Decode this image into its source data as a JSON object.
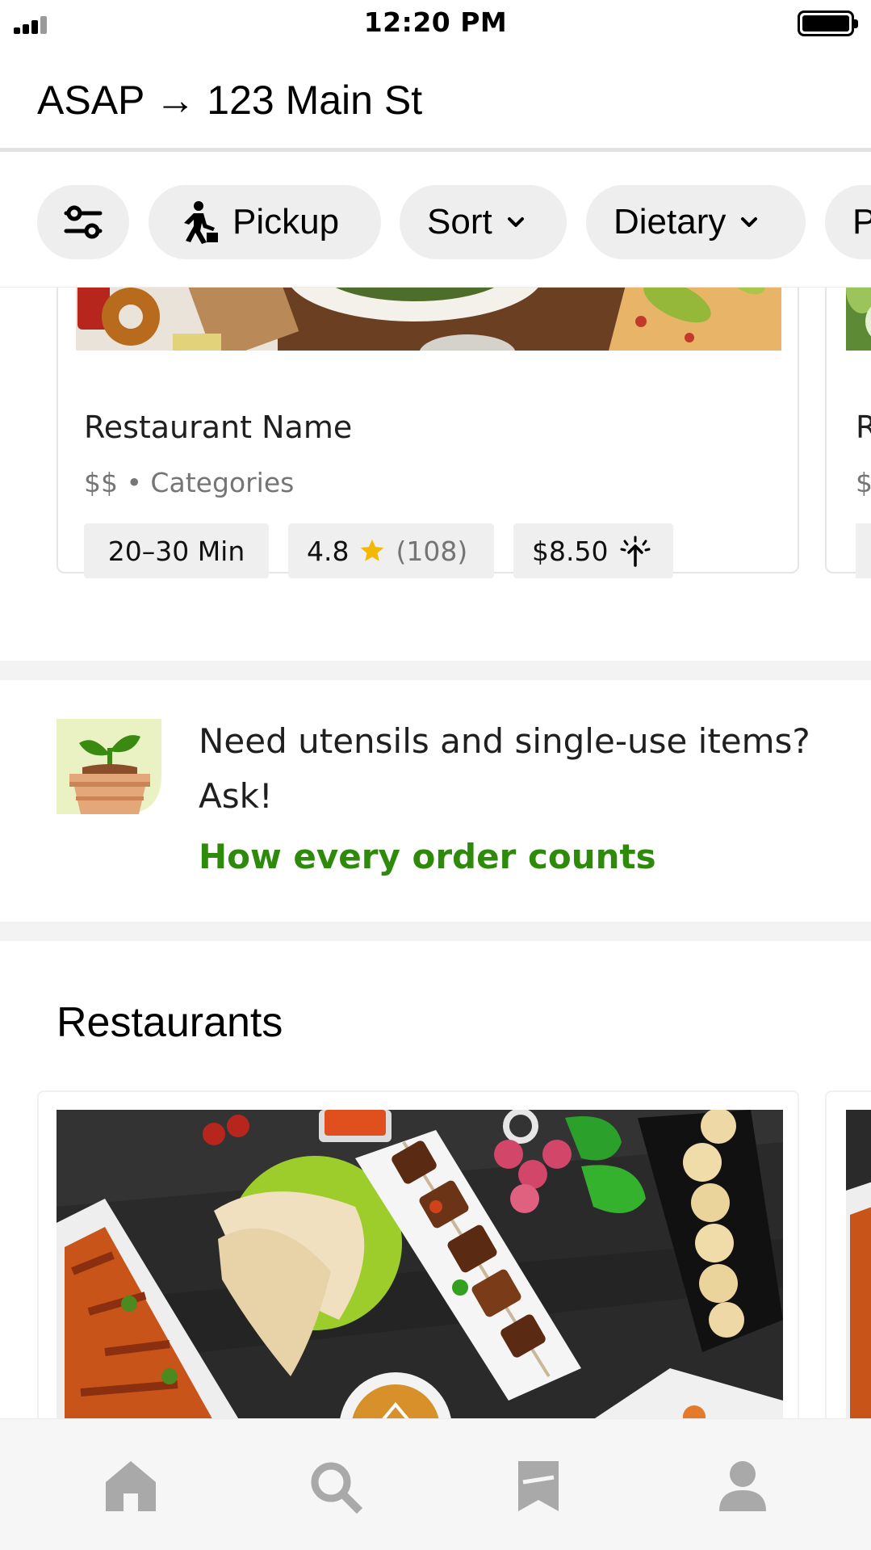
{
  "status_bar": {
    "time": "12:20 PM"
  },
  "header": {
    "address": "ASAP → 123 Main St"
  },
  "filters": [
    {
      "label": "",
      "icon": "filter-sliders-icon"
    },
    {
      "label": "Pickup",
      "icon": "walking-person-icon"
    },
    {
      "label": "Sort",
      "icon": "chevron-down-icon"
    },
    {
      "label": "Dietary",
      "icon": "chevron-down-icon"
    },
    {
      "label": "P",
      "icon": ""
    }
  ],
  "featured_card": {
    "name": "Restaurant Name",
    "meta": "$$ • Categories",
    "time": "20–30 Min",
    "rating": "4.8",
    "rating_count": "(108)",
    "fee": "$8.50",
    "peek_name": "R",
    "peek_meta": "$"
  },
  "sustainability": {
    "text": "Need utensils and single-use items? Ask!",
    "link": "How every order counts"
  },
  "restaurants": {
    "title": "Restaurants"
  },
  "bottom_nav": [
    {
      "name": "home",
      "icon": "home-icon",
      "active": true
    },
    {
      "name": "search",
      "icon": "search-icon"
    },
    {
      "name": "saved",
      "icon": "bookmark-icon"
    },
    {
      "name": "account",
      "icon": "person-icon"
    }
  ],
  "colors": {
    "accent_green": "#2e8a0a",
    "chip_bg": "#eeeeee",
    "star": "#f5b800"
  }
}
